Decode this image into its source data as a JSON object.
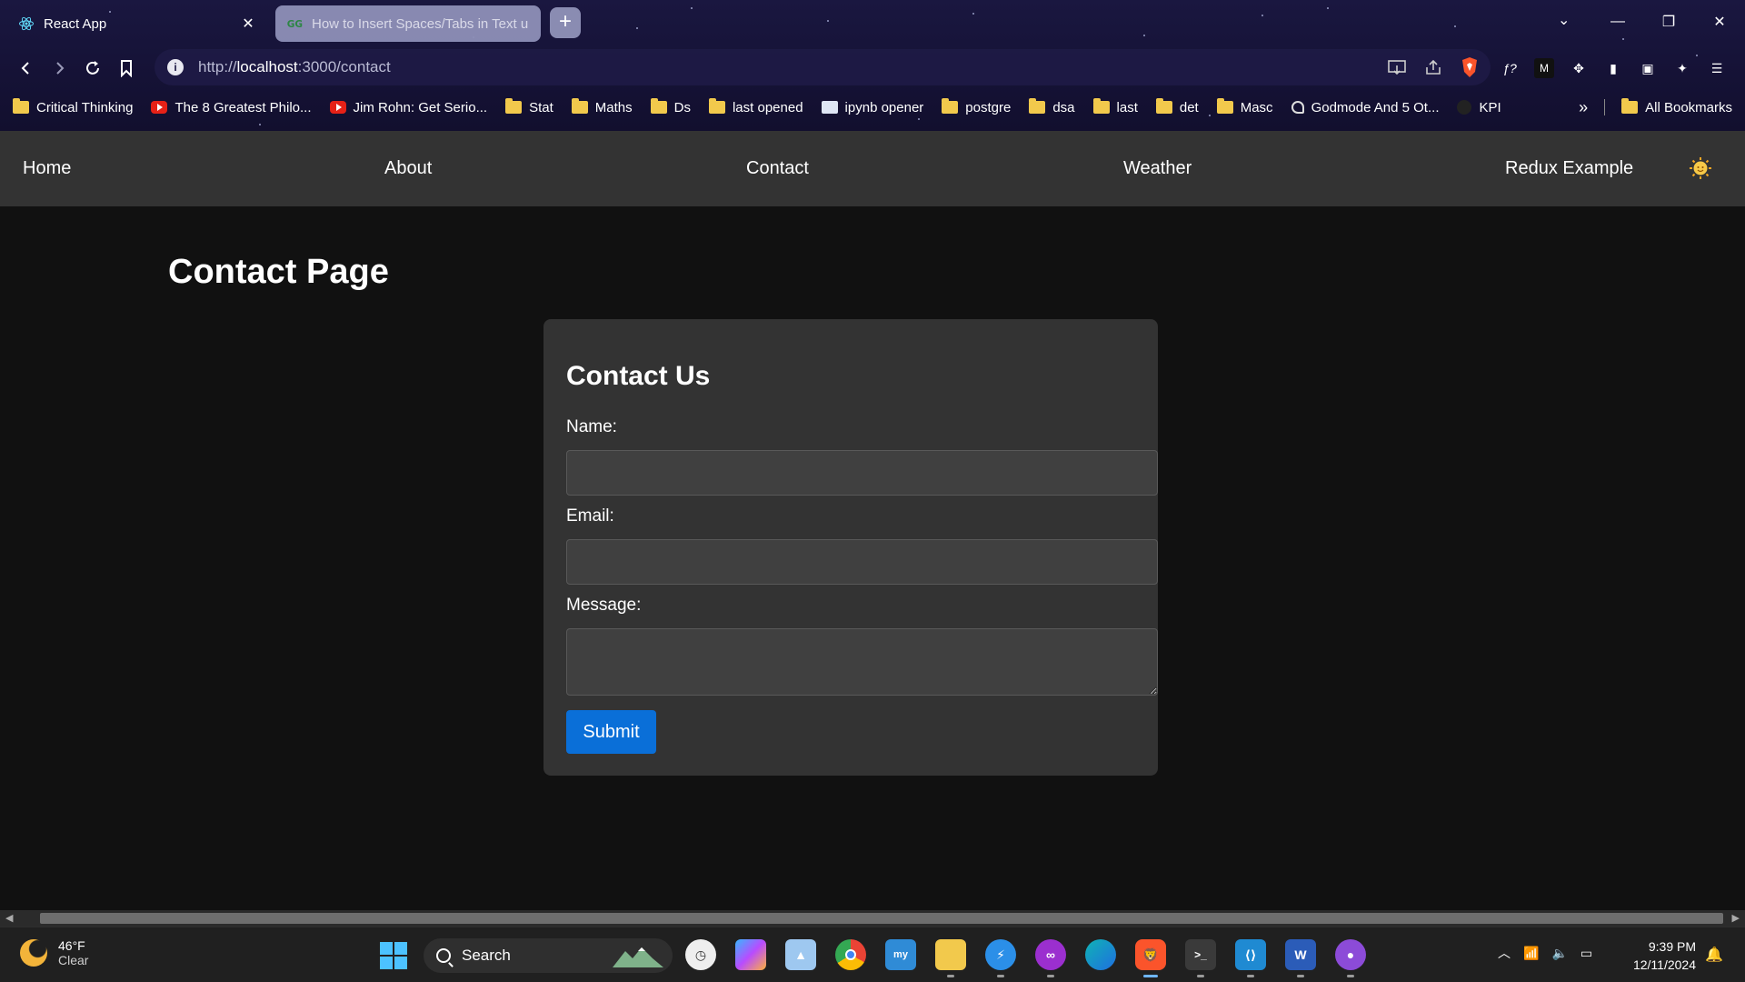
{
  "browser": {
    "tabs": [
      {
        "title": "React App",
        "active": true
      },
      {
        "title": "How to Insert Spaces/Tabs in Text u",
        "active": false
      }
    ],
    "url_prefix": "http://",
    "url_host": "localhost",
    "url_path": ":3000/contact",
    "bookmarks": [
      {
        "label": "Critical Thinking",
        "icon": "folder-icon"
      },
      {
        "label": "The 8 Greatest Philo...",
        "icon": "youtube-icon"
      },
      {
        "label": "Jim Rohn: Get Serio...",
        "icon": "youtube-icon"
      },
      {
        "label": "Stat",
        "icon": "folder-icon"
      },
      {
        "label": "Maths",
        "icon": "folder-icon"
      },
      {
        "label": "Ds",
        "icon": "folder-icon"
      },
      {
        "label": "last opened",
        "icon": "folder-icon"
      },
      {
        "label": "ipynb opener",
        "icon": "notebook-icon"
      },
      {
        "label": "postgre",
        "icon": "folder-icon"
      },
      {
        "label": "dsa",
        "icon": "folder-icon"
      },
      {
        "label": "last",
        "icon": "folder-icon"
      },
      {
        "label": "det",
        "icon": "folder-icon"
      },
      {
        "label": "Masc",
        "icon": "folder-icon"
      },
      {
        "label": "Godmode And 5 Ot...",
        "icon": "site-icon"
      },
      {
        "label": "KPI",
        "icon": "github-icon"
      }
    ],
    "overflow_label": "»",
    "all_bookmarks_label": "All Bookmarks"
  },
  "app": {
    "nav": {
      "home": "Home",
      "about": "About",
      "contact": "Contact",
      "weather": "Weather",
      "redux": "Redux Example"
    },
    "page_title": "Contact Page",
    "form": {
      "title": "Contact Us",
      "name_label": "Name:",
      "name_value": "",
      "email_label": "Email:",
      "email_value": "",
      "message_label": "Message:",
      "message_value": "",
      "submit_label": "Submit"
    }
  },
  "taskbar": {
    "weather_temp": "46°F",
    "weather_desc": "Clear",
    "search_placeholder": "Search",
    "time": "9:39 PM",
    "date": "12/11/2024"
  },
  "colors": {
    "page_bg": "#111111",
    "nav_bg": "#333333",
    "card_bg": "#333333",
    "input_bg": "#404040",
    "submit_bg": "#0a6fd8"
  }
}
